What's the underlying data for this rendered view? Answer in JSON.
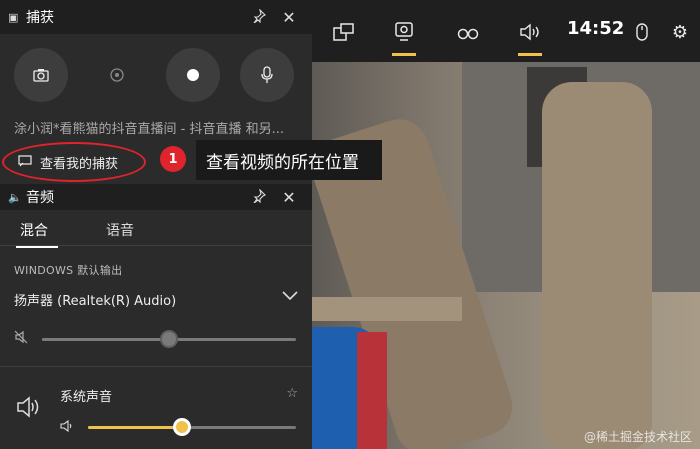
{
  "topbar": {
    "widgets_icon": "widgets-icon",
    "capture_icon": "capture-icon",
    "performance_icon": "binoculars-icon",
    "audio_icon": "speaker-icon",
    "time": "14:52",
    "mouse_icon": "mouse-icon",
    "settings_icon": "gear-icon",
    "accent_color": "#f0c24c"
  },
  "capture": {
    "title": "捕获",
    "description": "涂小润*看熊猫的抖音直播间 - 抖音直播 和另...",
    "link_label": "查看我的捕获"
  },
  "annotation": {
    "badge": "1",
    "tooltip": "查看视频的所在位置",
    "color": "#e0242b"
  },
  "audio": {
    "title": "音频",
    "tabs": [
      "混合",
      "语音"
    ],
    "output_label": "WINDOWS 默认输出",
    "device": "扬声器 (Realtek(R) Audio)",
    "device_volume": 0.5,
    "app_name": "系统声音",
    "app_volume": 0.45,
    "slider_color": "#f0c24c"
  },
  "watermark": "@稀土掘金技术社区"
}
